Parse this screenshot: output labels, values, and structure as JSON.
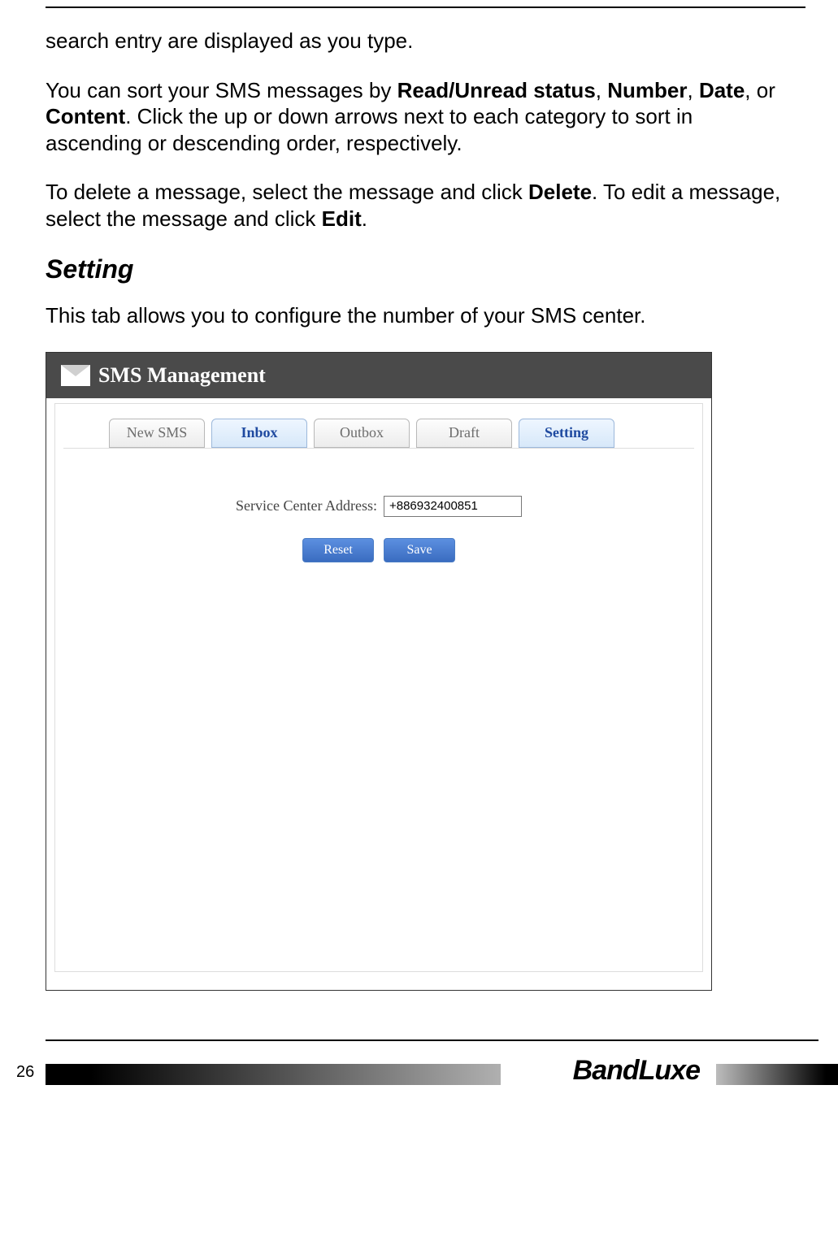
{
  "paragraphs": {
    "p1": "search entry are displayed as you type.",
    "p2_a": "You can sort your SMS messages by ",
    "p2_b1": "Read/Unread status",
    "p2_c1": ", ",
    "p2_b2": "Number",
    "p2_c2": ", ",
    "p2_b3": "Date",
    "p2_c3": ", or ",
    "p2_b4": "Content",
    "p2_d": ". Click the up or down arrows next to each category to sort in ascending or descending order, respectively.",
    "p3_a": "To delete a message, select the message and click ",
    "p3_b1": "Delete",
    "p3_c": ". To edit a message, select the message and click ",
    "p3_b2": "Edit",
    "p3_d": ".",
    "setting_heading": "Setting",
    "p4": "This tab allows you to configure the number of your SMS center."
  },
  "screenshot": {
    "title": "SMS Management",
    "tabs": {
      "new_sms": "New SMS",
      "inbox": "Inbox",
      "outbox": "Outbox",
      "draft": "Draft",
      "setting": "Setting"
    },
    "form": {
      "label": "Service Center Address:",
      "value": "+886932400851",
      "reset": "Reset",
      "save": "Save"
    }
  },
  "footer": {
    "page_number": "26",
    "brand": "BandLuxe"
  }
}
